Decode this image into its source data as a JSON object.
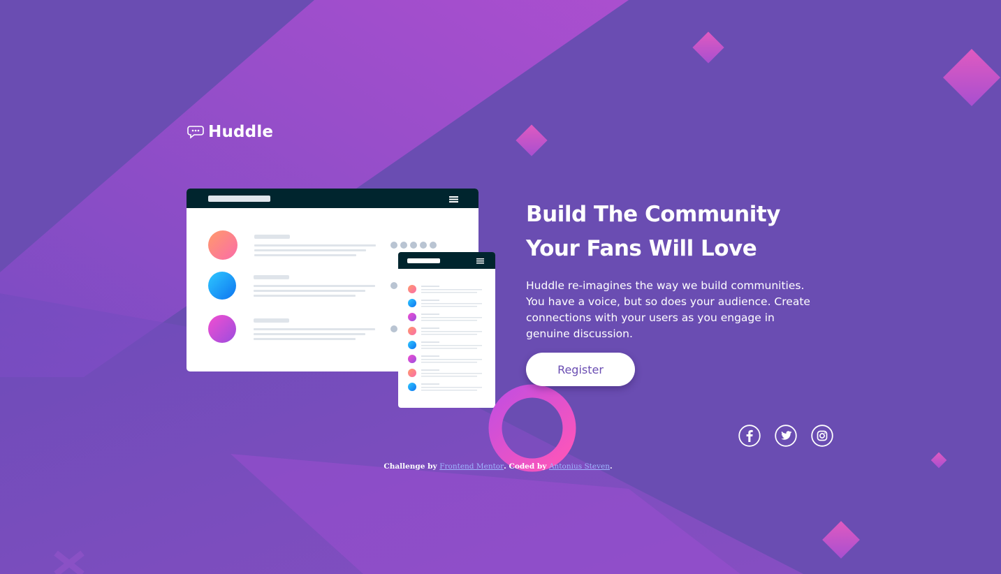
{
  "brand": {
    "name": "Huddle",
    "logo_icon": "chat-bubble-icon"
  },
  "hero": {
    "headline": "Build The Community Your Fans Will Love",
    "body": "Huddle re-imagines the way we build communities. You have a voice, but so does your audience. Create connections with your users as you engage in genuine discussion.",
    "register_label": "Register"
  },
  "social": [
    "facebook-icon",
    "twitter-icon",
    "instagram-icon"
  ],
  "footer": {
    "prefix": "Challenge by ",
    "link1": "Frontend Mentor",
    "middle": ". Coded by ",
    "link2": "Antonius Steven",
    "suffix": "."
  },
  "colors": {
    "background": "#6a4db2",
    "button_text": "#6a4db2",
    "accent_pink": "#d64fd8",
    "footer_link": "#9fb5ff"
  }
}
